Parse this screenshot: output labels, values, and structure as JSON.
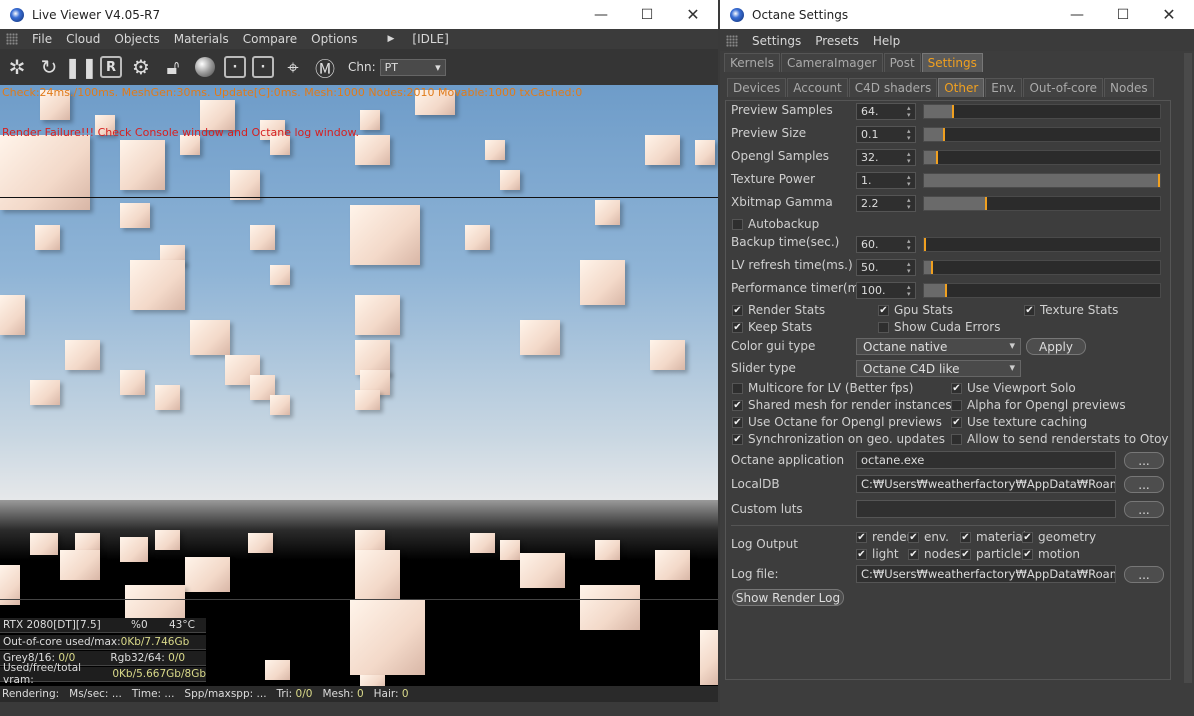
{
  "live_viewer": {
    "title": "Live Viewer V4.05-R7",
    "menu": [
      "File",
      "Cloud",
      "Objects",
      "Materials",
      "Compare",
      "Options"
    ],
    "state": "[IDLE]",
    "channel_label": "Chn:",
    "channel_value": "PT",
    "overlay_stats": "Check:24ms./100ms. MeshGen:30ms. Update[C]:0ms. Mesh:1000 Nodes:2010 Movable:1000 txCached:0",
    "render_failure": "Render Failure!!! Check Console window and Octane log window.",
    "gpu": {
      "name": "RTX 2080[DT][7.5]",
      "usage": "%0",
      "temp": "43°C"
    },
    "ooc_label": "Out-of-core used/max:",
    "ooc_value": "0Kb/7.746Gb",
    "grey_label": "Grey8/16:",
    "grey_value": "0/0",
    "rgb_label": "Rgb32/64:",
    "rgb_value": "0/0",
    "vram_label": "Used/free/total vram:",
    "vram_value": "0Kb/5.667Gb/8Gb",
    "status": {
      "rendering": "Rendering:",
      "ms_sec": "Ms/sec:",
      "ms_sec_v": "...",
      "time": "Time:",
      "time_v": "...",
      "spp": "Spp/maxspp:",
      "spp_v": "...",
      "tri": "Tri:",
      "tri_v": "0/0",
      "mesh": "Mesh:",
      "mesh_v": "0",
      "hair": "Hair:",
      "hair_v": "0"
    }
  },
  "octane_settings": {
    "title": "Octane Settings",
    "menu": [
      "Settings",
      "Presets",
      "Help"
    ],
    "tabs1": [
      "Kernels",
      "CameraImager",
      "Post",
      "Settings"
    ],
    "tabs2": [
      "Devices",
      "Account",
      "C4D shaders",
      "Other",
      "Env.",
      "Out-of-core",
      "Nodes"
    ],
    "fields": [
      {
        "label": "Preview Samples",
        "value": "64.",
        "fraction": 0.12
      },
      {
        "label": "Preview Size",
        "value": "0.1",
        "fraction": 0.08
      },
      {
        "label": "Opengl Samples",
        "value": "32.",
        "fraction": 0.05
      },
      {
        "label": "Texture Power",
        "value": "1.",
        "fraction": 1.0
      },
      {
        "label": "Xbitmap Gamma",
        "value": "2.2",
        "fraction": 0.26
      }
    ],
    "autobackup": "Autobackup",
    "fields2": [
      {
        "label": "Backup time(sec.)",
        "value": "60.",
        "fraction": 0.0
      },
      {
        "label": "LV refresh time(ms.)",
        "value": "50.",
        "fraction": 0.03
      },
      {
        "label": "Performance timer(ms.)",
        "value": "100.",
        "fraction": 0.09
      }
    ],
    "checks_a": [
      {
        "label": "Render Stats",
        "checked": true
      },
      {
        "label": "Gpu Stats",
        "checked": true
      },
      {
        "label": "Texture Stats",
        "checked": true
      },
      {
        "label": "Keep Stats",
        "checked": true
      },
      {
        "label": "Show Cuda Errors",
        "checked": false
      }
    ],
    "color_gui_label": "Color gui type",
    "color_gui_value": "Octane native",
    "apply": "Apply",
    "slider_type_label": "Slider type",
    "slider_type_value": "Octane C4D like",
    "checks_b": [
      {
        "label": "Multicore for LV (Better fps)",
        "checked": false
      },
      {
        "label": "Use Viewport Solo",
        "checked": true
      },
      {
        "label": "Shared mesh for render instances",
        "checked": true
      },
      {
        "label": "Alpha for Opengl previews",
        "checked": false
      },
      {
        "label": "Use Octane for Opengl previews",
        "checked": true
      },
      {
        "label": "Use texture caching",
        "checked": true
      },
      {
        "label": "Synchronization on geo. updates",
        "checked": true
      },
      {
        "label": "Allow to send renderstats to Otoy",
        "checked": false
      }
    ],
    "octane_app_label": "Octane application",
    "octane_app_value": "octane.exe",
    "localdb_label": "LocalDB",
    "localdb_value": "C:₩Users₩weatherfactory₩AppData₩Roaming₩O",
    "custom_luts_label": "Custom luts",
    "custom_luts_value": "",
    "browse": "...",
    "log_output_label": "Log Output",
    "log_checks": [
      {
        "label": "render",
        "checked": true
      },
      {
        "label": "env.",
        "checked": true
      },
      {
        "label": "material",
        "checked": true
      },
      {
        "label": "geometry",
        "checked": true
      },
      {
        "label": "light",
        "checked": true
      },
      {
        "label": "nodes",
        "checked": true
      },
      {
        "label": "particle",
        "checked": true
      },
      {
        "label": "motion",
        "checked": true
      }
    ],
    "log_file_label": "Log file:",
    "log_file_value": "C:₩Users₩weatherfactory₩AppData₩Roaming₩M",
    "show_render_log": "Show Render Log"
  },
  "colors": {
    "accent": "#f0a020",
    "overlay_stats": "#e07b1a",
    "error": "#d62020",
    "hud_value": "#dada8a"
  }
}
